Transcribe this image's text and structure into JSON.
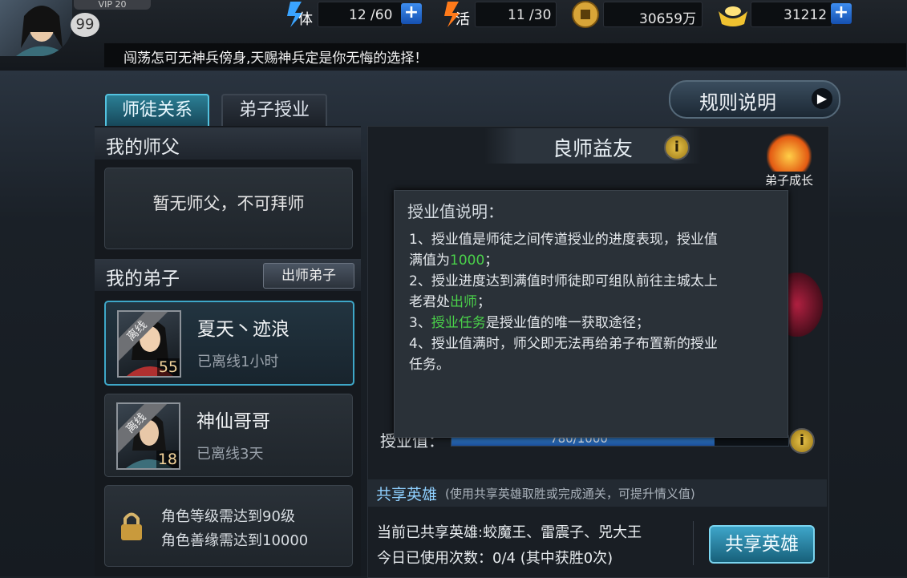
{
  "topbar": {
    "vip_label": "VIP 20",
    "player_level": "99",
    "stamina": {
      "label": "体",
      "value": "12 /60"
    },
    "energy": {
      "label": "活",
      "value": "11 /30"
    },
    "coins": {
      "value": "30659万"
    },
    "ingots": {
      "value": "31212"
    },
    "plus_symbol": "+",
    "marquee": "闯荡怎可无神兵傍身,天赐神兵定是你无悔的选择！"
  },
  "tabs": [
    "师徒关系",
    "弟子授业"
  ],
  "rules_button": {
    "label": "规则说明",
    "arrow": "▶"
  },
  "left": {
    "master_section": "我的师父",
    "master_empty": "暂无师父，不可拜师",
    "disciples_section": "我的弟子",
    "graduate_button": "出师弟子",
    "disciples": [
      {
        "name": "夏天丶迹浪",
        "level": "55",
        "status": "已离线1小时",
        "tag": "离线"
      },
      {
        "name": "神仙哥哥",
        "level": "18",
        "status": "已离线3天",
        "tag": "离线"
      }
    ],
    "lock": {
      "line1": "角色等级需达到90级",
      "line2": "角色善缘需达到10000"
    }
  },
  "right": {
    "title": "良师益友",
    "info_glyph": "i",
    "growth_label": "弟子成长",
    "tooltip": {
      "title": "授业值说明：",
      "l1": "1、授业值是师徒之间传道授业的进度表现，授业值",
      "l2a": "满值为",
      "l2b": "1000",
      "l2c": "；",
      "l3": "2、授业进度达到满值时师徒即可组队前往主城太上",
      "l4a": "老君处",
      "l4b": "出师",
      "l4c": "；",
      "l5a": "3、",
      "l5b": "授业任务",
      "l5c": "是授业值的唯一获取途径；",
      "l6": "4、授业值满时，师父即无法再给弟子布置新的授业",
      "l7": "任务。"
    },
    "progress": {
      "label": "授业值：",
      "text": "780/1000",
      "fraction": 0.78
    },
    "share": {
      "title": "共享英雄",
      "desc": "(使用共享英雄取胜或完成通关，可提升情义值)",
      "current": "当前已共享英雄:蛟魔王、雷震子、兕大王",
      "usage": "今日已使用次数：0/4 (其中获胜0次)",
      "button": "共享英雄"
    }
  }
}
